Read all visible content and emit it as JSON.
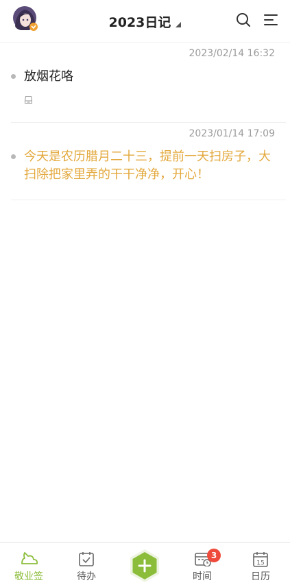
{
  "header": {
    "title": "2023日记",
    "avatar_icon": "user-avatar",
    "search_icon": "search-icon",
    "menu_icon": "menu-icon"
  },
  "entries": [
    {
      "date": "2023/02/14 16:32",
      "text": "放烟花咯",
      "text_color": "#222222",
      "attachment_icon": "drive-icon"
    },
    {
      "date": "2023/01/14 17:09",
      "text": "今天是农历腊月二十三，提前一天扫房子，大扫除把家里弄的干干净净，开心！",
      "text_color": "#e3a83c"
    }
  ],
  "tabbar": {
    "items": [
      {
        "label": "敬业签",
        "icon": "cloud-logo-icon",
        "active": true
      },
      {
        "label": "待办",
        "icon": "calendar-check-icon",
        "active": false
      },
      {
        "label": "",
        "icon": "plus-icon",
        "active": false
      },
      {
        "label": "时间",
        "icon": "calendar-clock-icon",
        "active": false,
        "badge": "3"
      },
      {
        "label": "日历",
        "icon": "calendar-15-icon",
        "active": false,
        "day": "15"
      }
    ]
  },
  "colors": {
    "accent": "#8bbd3b",
    "highlight_text": "#e3a83c",
    "badge": "#ef4b3c"
  }
}
